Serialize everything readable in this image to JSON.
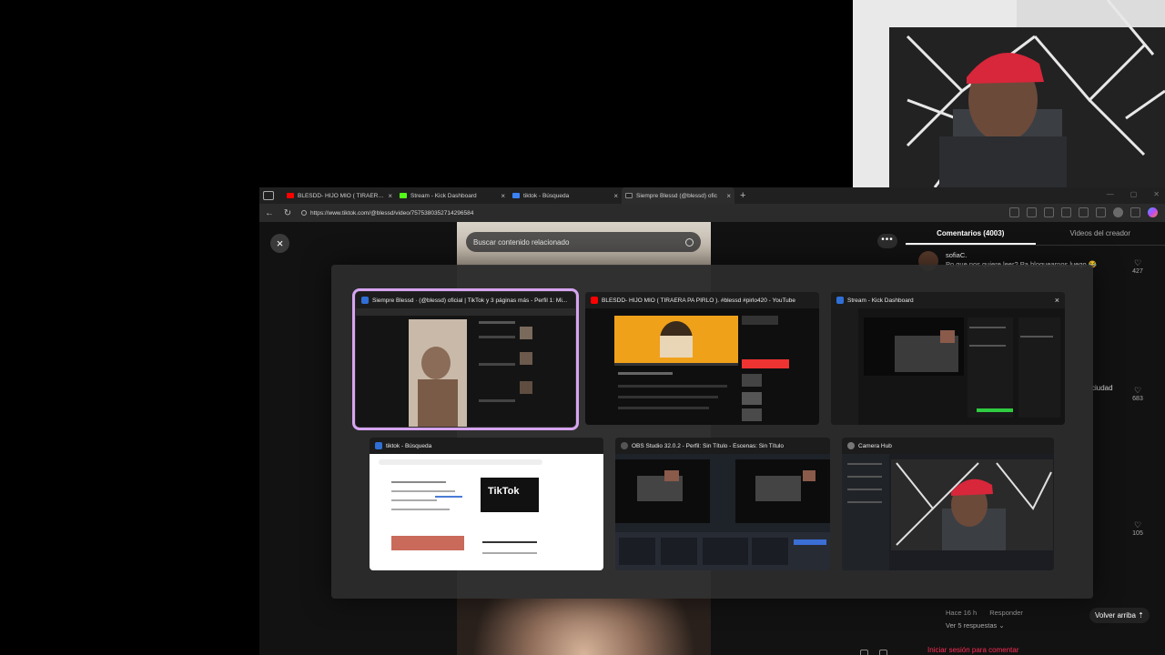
{
  "browser": {
    "tabs": [
      {
        "label": "BLESDD- HIJO MIO ( TIRAERA PA",
        "favicon_color": "#ff0000",
        "active": false
      },
      {
        "label": "Stream - Kick Dashboard",
        "favicon_color": "#53fc18",
        "active": false
      },
      {
        "label": "tiktok - Búsqueda",
        "favicon_color": "#3b82f6",
        "active": false
      },
      {
        "label": "Siempre Blessd (@blessd) ofic",
        "favicon_color": "#222222",
        "active": true
      }
    ],
    "new_tab_symbol": "+",
    "url": "https://www.tiktok.com/@blessd/video/7575380352714296584"
  },
  "tiktok": {
    "search_placeholder": "Buscar contenido relacionado",
    "close_symbol": "×",
    "more_symbol": "•••",
    "comments_tab": "Comentarios (4003)",
    "creator_videos_tab": "Videos del creador",
    "top_comment": {
      "author": "sofiaC.",
      "text": "Po que nos quiere leer? Pa bloquearnos luego 😂",
      "likes": "427"
    },
    "mid_comment_tail": "ciudad",
    "mid_likes": "683",
    "lower_likes": "105",
    "reply_time": "Hace 16 h",
    "reply_label": "Responder",
    "view_replies": "Ver 5 respuestas ⌄",
    "back_to_top": "Volver arriba ⇡",
    "login_prompt": "Iniciar sesión para comentar"
  },
  "switcher": {
    "windows": [
      {
        "title": "Siempre Blessd · (@blessd) oficial | TikTok y 3 páginas más - Perfil 1: Mi...",
        "favicon_color": "#2f6fd6",
        "selected": true
      },
      {
        "title": "BLESDD- HIJO MIO ( TIRAERA PA PIRLO ). #blessd #pirlo420 - YouTube",
        "favicon_color": "#ff0000",
        "selected": false
      },
      {
        "title": "Stream - Kick Dashboard",
        "favicon_color": "#2f6fd6",
        "selected": false,
        "close_symbol": "×"
      },
      {
        "title": "tiktok - Búsqueda",
        "favicon_color": "#2f6fd6",
        "selected": false
      },
      {
        "title": "OBS Studio 32.0.2 - Perfil: Sin Título - Escenas: Sin Título",
        "favicon_color": "#555555",
        "selected": false
      },
      {
        "title": "Camera Hub",
        "favicon_color": "#777777",
        "selected": false
      }
    ],
    "tiktok_logo_text": "TikTok"
  }
}
